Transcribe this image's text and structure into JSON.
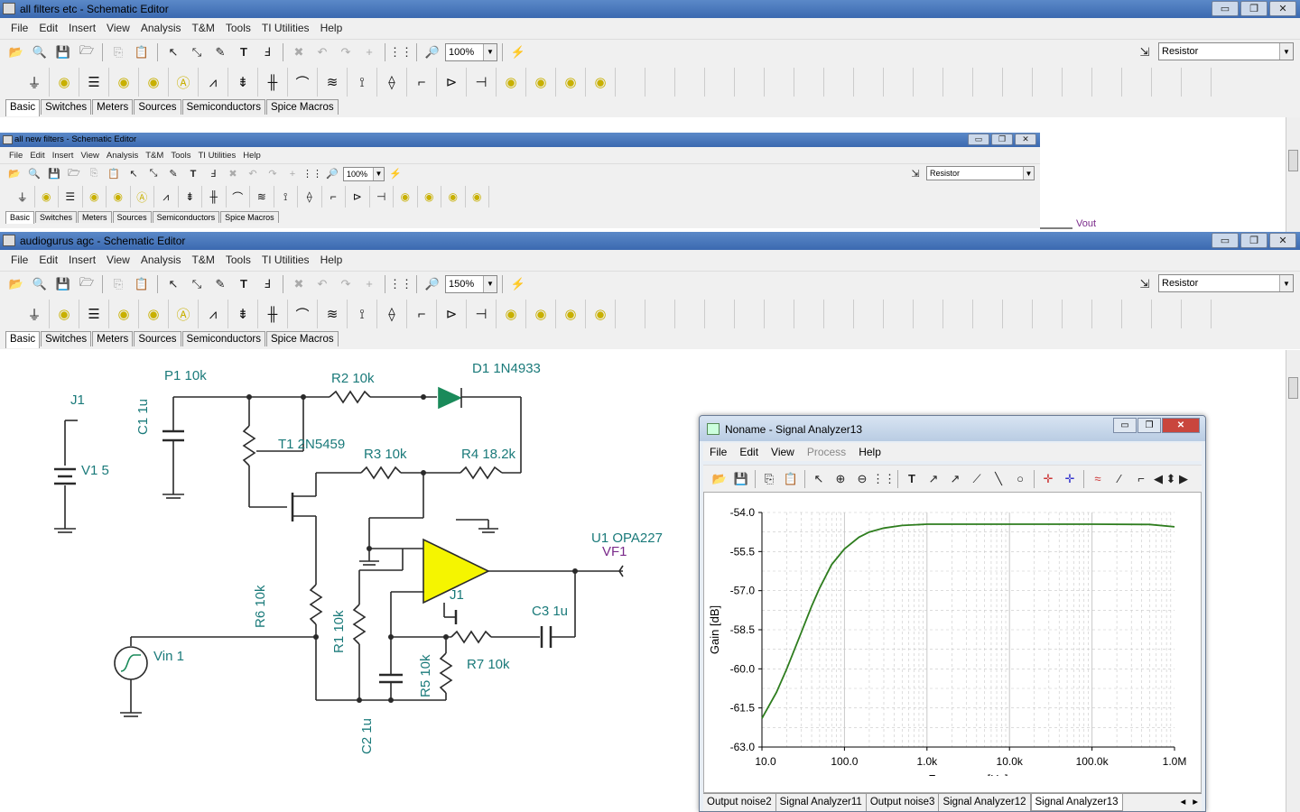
{
  "windows": {
    "win1": {
      "title": "all filters etc - Schematic Editor",
      "zoom": "100%",
      "component": "Resistor"
    },
    "win2": {
      "title": "all new filters - Schematic Editor",
      "zoom": "100%",
      "component": "Resistor",
      "net_label": "Vout"
    },
    "win3": {
      "title": "audiogurus agc - Schematic Editor",
      "zoom": "150%",
      "component": "Resistor"
    }
  },
  "window_buttons": {
    "minimize": "▭",
    "restore": "❐",
    "close": "✕"
  },
  "menu": [
    "File",
    "Edit",
    "Insert",
    "View",
    "Analysis",
    "T&M",
    "Tools",
    "TI Utilities",
    "Help"
  ],
  "component_tabs": [
    "Basic",
    "Switches",
    "Meters",
    "Sources",
    "Semiconductors",
    "Spice Macros"
  ],
  "schematic_labels": {
    "p1": "P1 10k",
    "r2": "R2 10k",
    "d1": "D1 1N4933",
    "j1_top": "J1",
    "c1": "C1 1u",
    "t1": "T1 2N5459",
    "r3": "R3 10k",
    "r4": "R4 18.2k",
    "v1": "V1 5",
    "u1": "U1 OPA227",
    "vf1": "VF1",
    "j1_op": "J1",
    "r6": "R6 10k",
    "r1": "R1 10k",
    "c3": "C3 1u",
    "vin": "Vin 1",
    "r5": "R5 10k",
    "r7": "R7 10k",
    "c2": "C2 1u"
  },
  "analyzer": {
    "title": "Noname - Signal Analyzer13",
    "menu": [
      "File",
      "Edit",
      "View",
      "Process",
      "Help"
    ],
    "tabs": [
      "Output noise2",
      "Signal Analyzer11",
      "Output noise3",
      "Signal Analyzer12",
      "Signal Analyzer13"
    ],
    "active_tab": "Signal Analyzer13"
  },
  "chart_data": {
    "type": "line",
    "xlabel": "Frequency [Hz]",
    "ylabel": "Gain [dB]",
    "x_scale": "log",
    "xlim": [
      10,
      1000000
    ],
    "ylim": [
      -63.0,
      -54.0
    ],
    "x_ticks": [
      "10.0",
      "100.0",
      "1.0k",
      "10.0k",
      "100.0k",
      "1.0M"
    ],
    "y_ticks": [
      "-54.0",
      "-55.5",
      "-57.0",
      "-58.5",
      "-60.0",
      "-61.5",
      "-63.0"
    ],
    "grid": true,
    "line_color": "#2e7d1e",
    "series": [
      {
        "x": [
          10,
          15,
          20,
          30,
          40,
          50,
          70,
          100,
          150,
          200,
          300,
          500,
          1000,
          10000,
          100000,
          500000,
          1000000
        ],
        "values": [
          -61.9,
          -60.9,
          -60.0,
          -58.6,
          -57.6,
          -56.9,
          -56.0,
          -55.4,
          -54.95,
          -54.75,
          -54.6,
          -54.5,
          -54.45,
          -54.45,
          -54.45,
          -54.46,
          -54.55
        ]
      }
    ]
  }
}
